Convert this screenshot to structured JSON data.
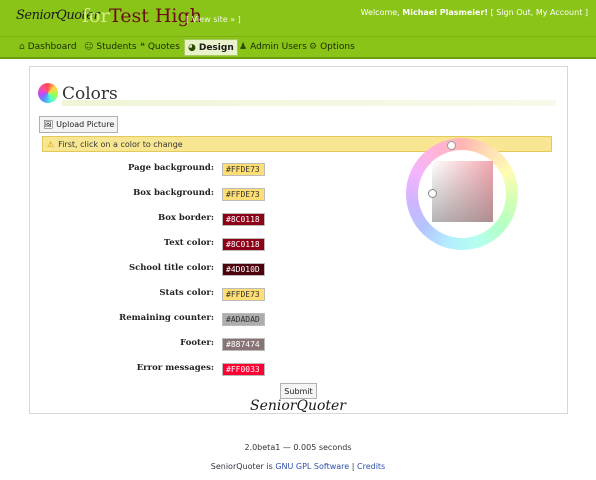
{
  "header": {
    "logo": "SeniorQuoter",
    "for_text": "for",
    "school_name": "Test High",
    "view_site": "[ View site » ]",
    "welcome_prefix": "Welcome,",
    "user_name": "Michael Plasmeier!",
    "signout": "[ Sign Out,",
    "my_account": "My Account ]"
  },
  "nav": {
    "items": [
      {
        "label": "Dashboard",
        "icon": "home-icon"
      },
      {
        "label": "Students",
        "icon": "students-icon"
      },
      {
        "label": "Quotes",
        "icon": "quotes-icon"
      },
      {
        "label": "Design",
        "icon": "design-icon"
      },
      {
        "label": "Admin Users",
        "icon": "admin-users-icon"
      },
      {
        "label": "Options",
        "icon": "gear-icon"
      }
    ],
    "active": "Design"
  },
  "page": {
    "title": "Colors",
    "upload_label": "Upload Picture",
    "alert_text": "First, click on a color to change",
    "submit_label": "Submit"
  },
  "colors": [
    {
      "label": "Page background:",
      "value": "#FFDE73",
      "bg": "#FFDE73",
      "fg": "#333333"
    },
    {
      "label": "Box background:",
      "value": "#FFDE73",
      "bg": "#FFDE73",
      "fg": "#333333"
    },
    {
      "label": "Box border:",
      "value": "#8C0118",
      "bg": "#8C0118",
      "fg": "#ffffff"
    },
    {
      "label": "Text color:",
      "value": "#8C0118",
      "bg": "#8C0118",
      "fg": "#ffffff"
    },
    {
      "label": "School title color:",
      "value": "#4D010D",
      "bg": "#4D010D",
      "fg": "#ffffff"
    },
    {
      "label": "Stats color:",
      "value": "#FFDE73",
      "bg": "#FFDE73",
      "fg": "#333333"
    },
    {
      "label": "Remaining counter:",
      "value": "#ADADAD",
      "bg": "#ADADAD",
      "fg": "#333333"
    },
    {
      "label": "Footer:",
      "value": "#887474",
      "bg": "#887474",
      "fg": "#ffffff"
    },
    {
      "label": "Error messages:",
      "value": "#FF0033",
      "bg": "#FF0033",
      "fg": "#ffffff"
    }
  ],
  "footer": {
    "logo": "SeniorQuoter",
    "version": "2.0beta1 — 0.005 seconds",
    "line_prefix": "SeniorQuoter is",
    "gpl": "GNU GPL Software",
    "sep": "|",
    "credits": "Credits"
  },
  "theme": {
    "accent": "#8AC418",
    "alert_bg": "#F8E693"
  }
}
